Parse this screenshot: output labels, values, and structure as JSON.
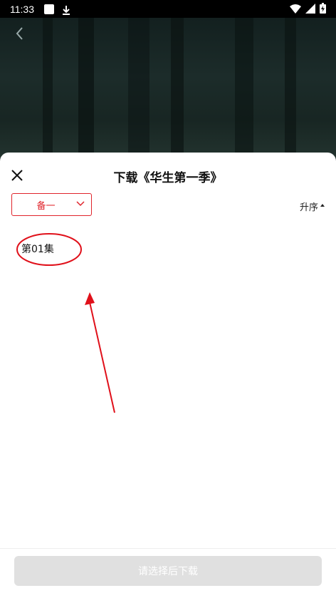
{
  "status_bar": {
    "time": "11:33"
  },
  "sheet": {
    "title": "下载《华生第一季》",
    "source_selected": "备一",
    "sort_label": "升序",
    "episodes": [
      {
        "label": "第01集"
      }
    ],
    "download_button_label": "请选择后下载"
  },
  "colors": {
    "accent": "#e0242b",
    "button_disabled": "#e0e0e0"
  }
}
